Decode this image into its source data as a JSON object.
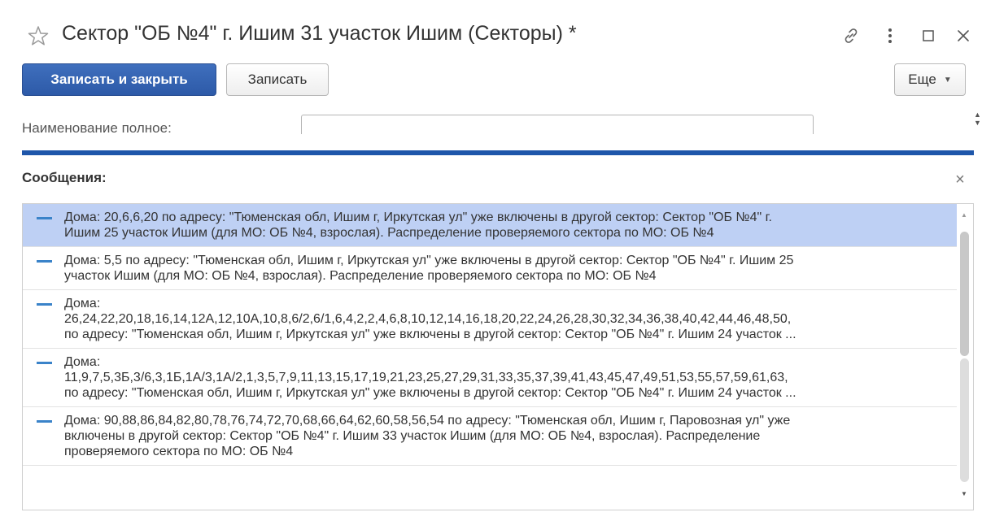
{
  "window": {
    "title": "Сектор \"ОБ №4\" г. Ишим  31 участок Ишим (Секторы) *",
    "icons": {
      "favorite": "star-icon",
      "link": "link-icon",
      "more": "more-vertical-icon",
      "maximize": "maximize-icon",
      "close": "close-icon"
    }
  },
  "toolbar": {
    "save_close_label": "Записать и закрыть",
    "save_label": "Записать",
    "more_label": "Еще"
  },
  "form": {
    "full_name_label": "Наименование полное:",
    "full_name_value": ""
  },
  "messages": {
    "title": "Сообщения:",
    "items": [
      {
        "lines": [
          "Дома: 20,6,6,20 по адресу: \"Тюменская обл, Ишим г, Иркутская ул\" уже включены в другой сектор: Сектор \"ОБ №4\" г.",
          "Ишим  25 участок Ишим (для МО: ОБ №4, взрослая). Распределение проверяемого сектора по МО: ОБ №4"
        ]
      },
      {
        "lines": [
          "Дома: 5,5 по адресу: \"Тюменская обл, Ишим г, Иркутская ул\" уже включены в другой сектор: Сектор \"ОБ №4\" г. Ишим  25",
          "участок Ишим (для МО: ОБ №4, взрослая). Распределение проверяемого сектора по МО: ОБ №4"
        ]
      },
      {
        "lines": [
          "Дома:",
          "26,24,22,20,18,16,14,12А,12,10А,10,8,6/2,6/1,6,4,2,2,4,6,8,10,12,14,16,18,20,22,24,26,28,30,32,34,36,38,40,42,44,46,48,50,",
          " по адресу: \"Тюменская обл, Ишим г, Иркутская ул\" уже включены в другой сектор: Сектор \"ОБ №4\" г. Ишим  24 участок ..."
        ]
      },
      {
        "lines": [
          "Дома:",
          "11,9,7,5,3Б,3/6,3,1Б,1А/3,1А/2,1,3,5,7,9,11,13,15,17,19,21,23,25,27,29,31,33,35,37,39,41,43,45,47,49,51,53,55,57,59,61,63,",
          " по адресу: \"Тюменская обл, Ишим г, Иркутская ул\" уже включены в другой сектор: Сектор \"ОБ №4\" г. Ишим  24 участок ..."
        ]
      },
      {
        "lines": [
          "Дома: 90,88,86,84,82,80,78,76,74,72,70,68,66,64,62,60,58,56,54 по адресу: \"Тюменская обл, Ишим г, Паровозная ул\" уже",
          "включены в другой сектор: Сектор \"ОБ №4\" г. Ишим  33 участок Ишим (для МО: ОБ №4, взрослая). Распределение",
          "проверяемого сектора по МО: ОБ №4"
        ]
      }
    ],
    "selected_index": 0
  },
  "colors": {
    "primary_button": "#2d5aa8",
    "accent_bar": "#1e56aa",
    "selection": "#bed0f4",
    "dash": "#3a83c9"
  }
}
